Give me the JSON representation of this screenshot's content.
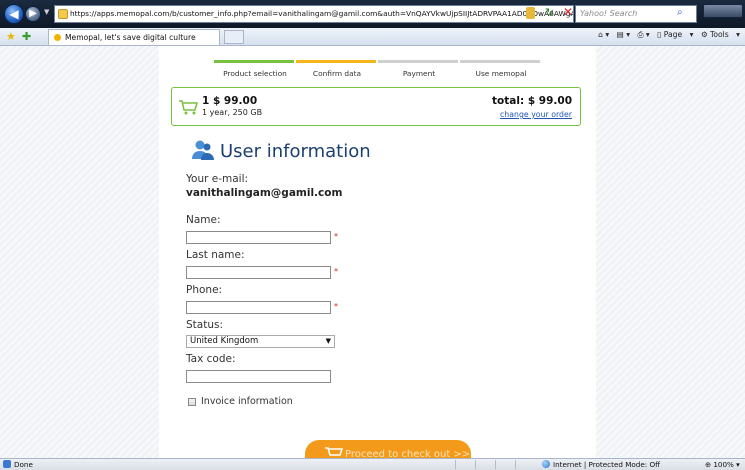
{
  "browser": {
    "address": "https://apps.memopal.com/b/customer_info.php?email=vanithalingam@gamil.com&auth=VnQAYVkwUjpSIIJtADRVPAA1AD0BOwA6AWgAE",
    "search_placeholder": "Yahoo! Search",
    "tab_title": "Memopal, let's save digital culture",
    "commands": {
      "page": "Page",
      "tools": "Tools"
    }
  },
  "steps": [
    {
      "label": "Product selection",
      "color": "#7ac142"
    },
    {
      "label": "Confirm data",
      "color": "#f3b51a"
    },
    {
      "label": "Payment",
      "color": "#cfcfcf"
    },
    {
      "label": "Use memopal",
      "color": "#cfcfcf"
    }
  ],
  "cart": {
    "price": "1 $ 99.00",
    "plan": "1 year, 250 GB",
    "total": "total: $ 99.00",
    "change_link": "change your order"
  },
  "form": {
    "title": "User information",
    "email_label": "Your e-mail:",
    "email_value": "vanithalingam@gamil.com",
    "name_label": "Name:",
    "last_name_label": "Last name:",
    "phone_label": "Phone:",
    "status_label": "Status:",
    "status_value": "United Kingdom",
    "tax_label": "Tax code:",
    "required_mark": "*",
    "invoice_label": "Invoice information",
    "checkout_label": "Proceed to check out >>"
  },
  "status": {
    "text": "Done",
    "zone": "Internet | Protected Mode: Off",
    "zoom": "100%"
  },
  "colors": {
    "accent_green": "#7ac142",
    "accent_orange": "#f39a1a",
    "title_blue": "#1b3f6e",
    "link_blue": "#2255bb"
  }
}
